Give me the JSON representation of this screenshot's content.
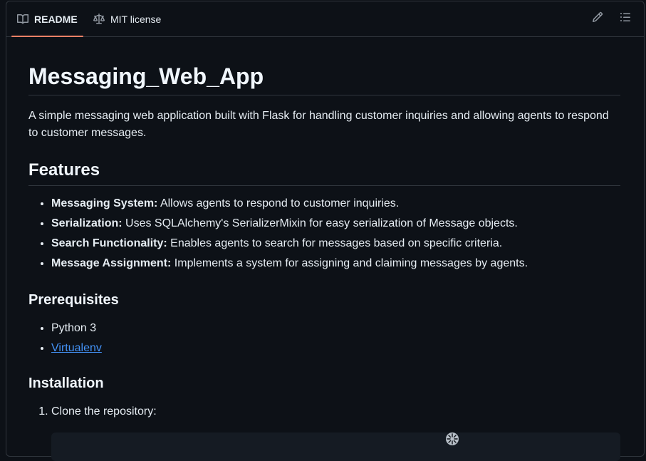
{
  "tabs": {
    "readme_label": "README",
    "license_label": "MIT license"
  },
  "icons": {
    "readme": "book-icon",
    "license": "law-icon",
    "edit": "pencil-icon",
    "outline": "list-unordered-icon"
  },
  "colors": {
    "background": "#0d1117",
    "border": "#30363d",
    "active_tab_underline": "#f78166",
    "link": "#4493f8",
    "text": "#e6edf3"
  },
  "readme": {
    "title": "Messaging_Web_App",
    "intro": "A simple messaging web application built with Flask for handling customer inquiries and allowing agents to respond to customer messages.",
    "features_heading": "Features",
    "features": [
      {
        "bold": "Messaging System:",
        "text": " Allows agents to respond to customer inquiries."
      },
      {
        "bold": "Serialization:",
        "text": " Uses SQLAlchemy's SerializerMixin for easy serialization of Message objects."
      },
      {
        "bold": "Search Functionality:",
        "text": " Enables agents to search for messages based on specific criteria."
      },
      {
        "bold": "Message Assignment:",
        "text": " Implements a system for assigning and claiming messages by agents."
      }
    ],
    "prerequisites_heading": "Prerequisites",
    "prerequisites": [
      "Python 3"
    ],
    "prerequisite_link": "Virtualenv",
    "installation_heading": "Installation",
    "installation_steps": [
      "Clone the repository:"
    ]
  }
}
